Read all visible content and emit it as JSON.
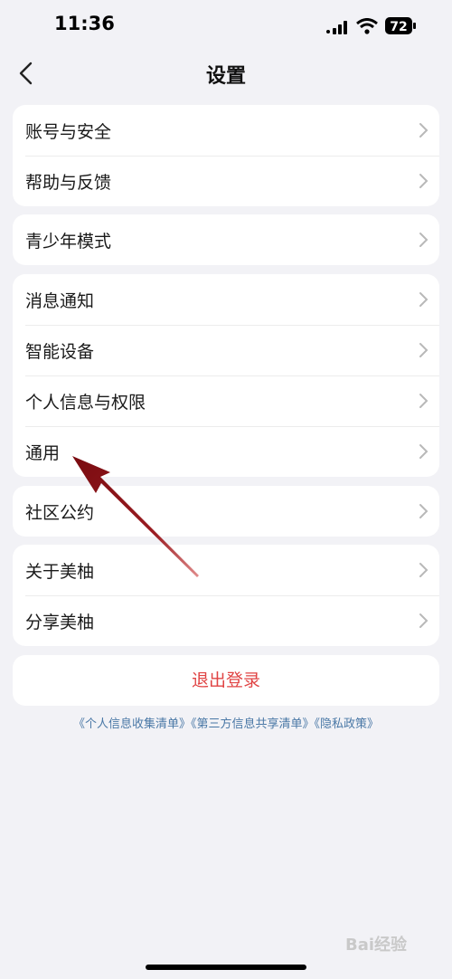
{
  "status_bar": {
    "time": "11:36",
    "battery": "72"
  },
  "nav": {
    "title": "设置"
  },
  "groups": [
    {
      "items": [
        {
          "label": "账号与安全"
        },
        {
          "label": "帮助与反馈"
        }
      ]
    },
    {
      "items": [
        {
          "label": "青少年模式"
        }
      ]
    },
    {
      "items": [
        {
          "label": "消息通知"
        },
        {
          "label": "智能设备"
        },
        {
          "label": "个人信息与权限"
        },
        {
          "label": "通用"
        }
      ]
    },
    {
      "items": [
        {
          "label": "社区公约"
        }
      ]
    },
    {
      "items": [
        {
          "label": "关于美柚"
        },
        {
          "label": "分享美柚"
        }
      ]
    }
  ],
  "logout": {
    "label": "退出登录"
  },
  "links": [
    "《个人信息收集清单》",
    "《第三方信息共享清单》",
    "《隐私政策》"
  ],
  "watermark": "Bai经验",
  "colors": {
    "background": "#f2f2f6",
    "logout_text": "#e04444",
    "link_text": "#4a78a6",
    "annotation_arrow": "#8b0f14"
  }
}
